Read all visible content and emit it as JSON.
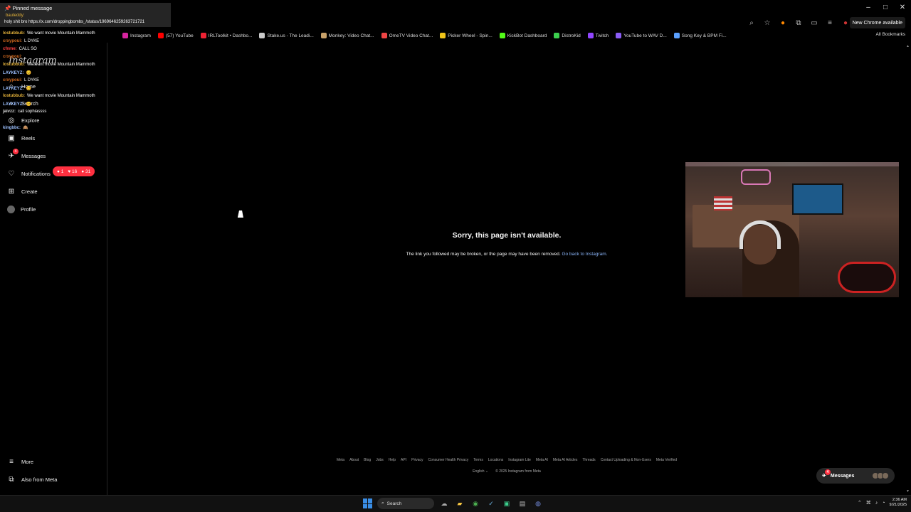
{
  "browser": {
    "window_controls": [
      "–",
      "□",
      "✕"
    ],
    "new_chrome_label": "New Chrome available",
    "bookmarks": [
      {
        "label": "Instagram",
        "color": "#d6249f"
      },
      {
        "label": "(57) YouTube",
        "color": "#ff0000"
      },
      {
        "label": "IRLToolkit • Dashbo...",
        "color": "#e23"
      },
      {
        "label": "Stake.us - The Leadi...",
        "color": "#cccccc"
      },
      {
        "label": "Monkey: Video Chat...",
        "color": "#c8a26a"
      },
      {
        "label": "OmeTV Video Chat...",
        "color": "#e44"
      },
      {
        "label": "Picker Wheel - Spin...",
        "color": "#f0c419"
      },
      {
        "label": "KickBot Dashboard",
        "color": "#53fc18"
      },
      {
        "label": "DistroKid",
        "color": "#3ccf4e"
      },
      {
        "label": "Twitch",
        "color": "#9146ff"
      },
      {
        "label": "YouTube to WAV D...",
        "color": "#8a5cf6"
      },
      {
        "label": "Song Key & BPM Fi...",
        "color": "#5aa0ff"
      }
    ],
    "all_bookmarks_label": "All Bookmarks"
  },
  "chat": {
    "pinned_title": "Pinned message",
    "pinned_user": "bauteddy:",
    "pinned_text": "holy shit bro https://x.com/droppingbombs_/status/1969646259263721721",
    "lines": [
      {
        "user": "lostubbub:",
        "text": "We want movie Mountain Mammoth",
        "color": "#e4b23a"
      },
      {
        "user": "crxypoui:",
        "text": "L DYKE",
        "color": "#d2691e"
      },
      {
        "user": "cfnme:",
        "text": "CALL SO",
        "color": "#ff4040"
      },
      {
        "user": "crxypoui:",
        "text": "",
        "color": "#d2691e"
      },
      {
        "user": "lostubbub:",
        "text": "We want movie Mountain Mammoth",
        "color": "#e4b23a"
      },
      {
        "user": "LAYKEYZ:",
        "text": "😊",
        "color": "#9cc0ff"
      },
      {
        "user": "crxypoui:",
        "text": "L DYKE",
        "color": "#d2691e"
      },
      {
        "user": "LAYKEYZ:",
        "text": "😊",
        "color": "#9cc0ff"
      },
      {
        "user": "lostubbub:",
        "text": "We want movie Mountain Mammoth",
        "color": "#e4b23a"
      },
      {
        "user": "LAYKEYZ:",
        "text": "😊",
        "color": "#9cc0ff"
      },
      {
        "user": "jaivzz:",
        "text": "call sophiassss",
        "color": "#d8d8d8"
      },
      {
        "user": "",
        "text": "",
        "color": "#ff4040"
      },
      {
        "user": "kingbbc:",
        "text": "🙈",
        "color": "#9cc0ff"
      }
    ]
  },
  "instagram": {
    "logo": "Instagram",
    "nav": [
      {
        "label": "Home",
        "icon": "⌂"
      },
      {
        "label": "Search",
        "icon": "⌕"
      },
      {
        "label": "Explore",
        "icon": "◎"
      },
      {
        "label": "Reels",
        "icon": "▣"
      },
      {
        "label": "Messages",
        "icon": "✈"
      },
      {
        "label": "Notifications",
        "icon": "♡"
      },
      {
        "label": "Create",
        "icon": "⊞"
      },
      {
        "label": "Profile",
        "icon": ""
      }
    ],
    "messages_badge": "4",
    "notif_pill": {
      "comments": "1",
      "likes": "16",
      "follows": "31"
    },
    "more_label": "More",
    "also_from_meta_label": "Also from Meta",
    "error_title": "Sorry, this page isn't available.",
    "error_sub": "The link you followed may be broken, or the page may have been removed.",
    "error_link": "Go back to Instagram.",
    "footer_links": [
      "Meta",
      "About",
      "Blog",
      "Jobs",
      "Help",
      "API",
      "Privacy",
      "Consumer Health Privacy",
      "Terms",
      "Locations",
      "Instagram Lite",
      "Meta AI",
      "Meta AI Articles",
      "Threads",
      "Contact Uploading & Non-Users",
      "Meta Verified"
    ],
    "footer_language": "English ⌄",
    "footer_copyright": "© 2025 Instagram from Meta",
    "messages_bubble_label": "Messages",
    "messages_bubble_badge": "4"
  },
  "taskbar": {
    "search_label": "Search",
    "time": "2:36 AM",
    "date": "9/21/2025"
  }
}
